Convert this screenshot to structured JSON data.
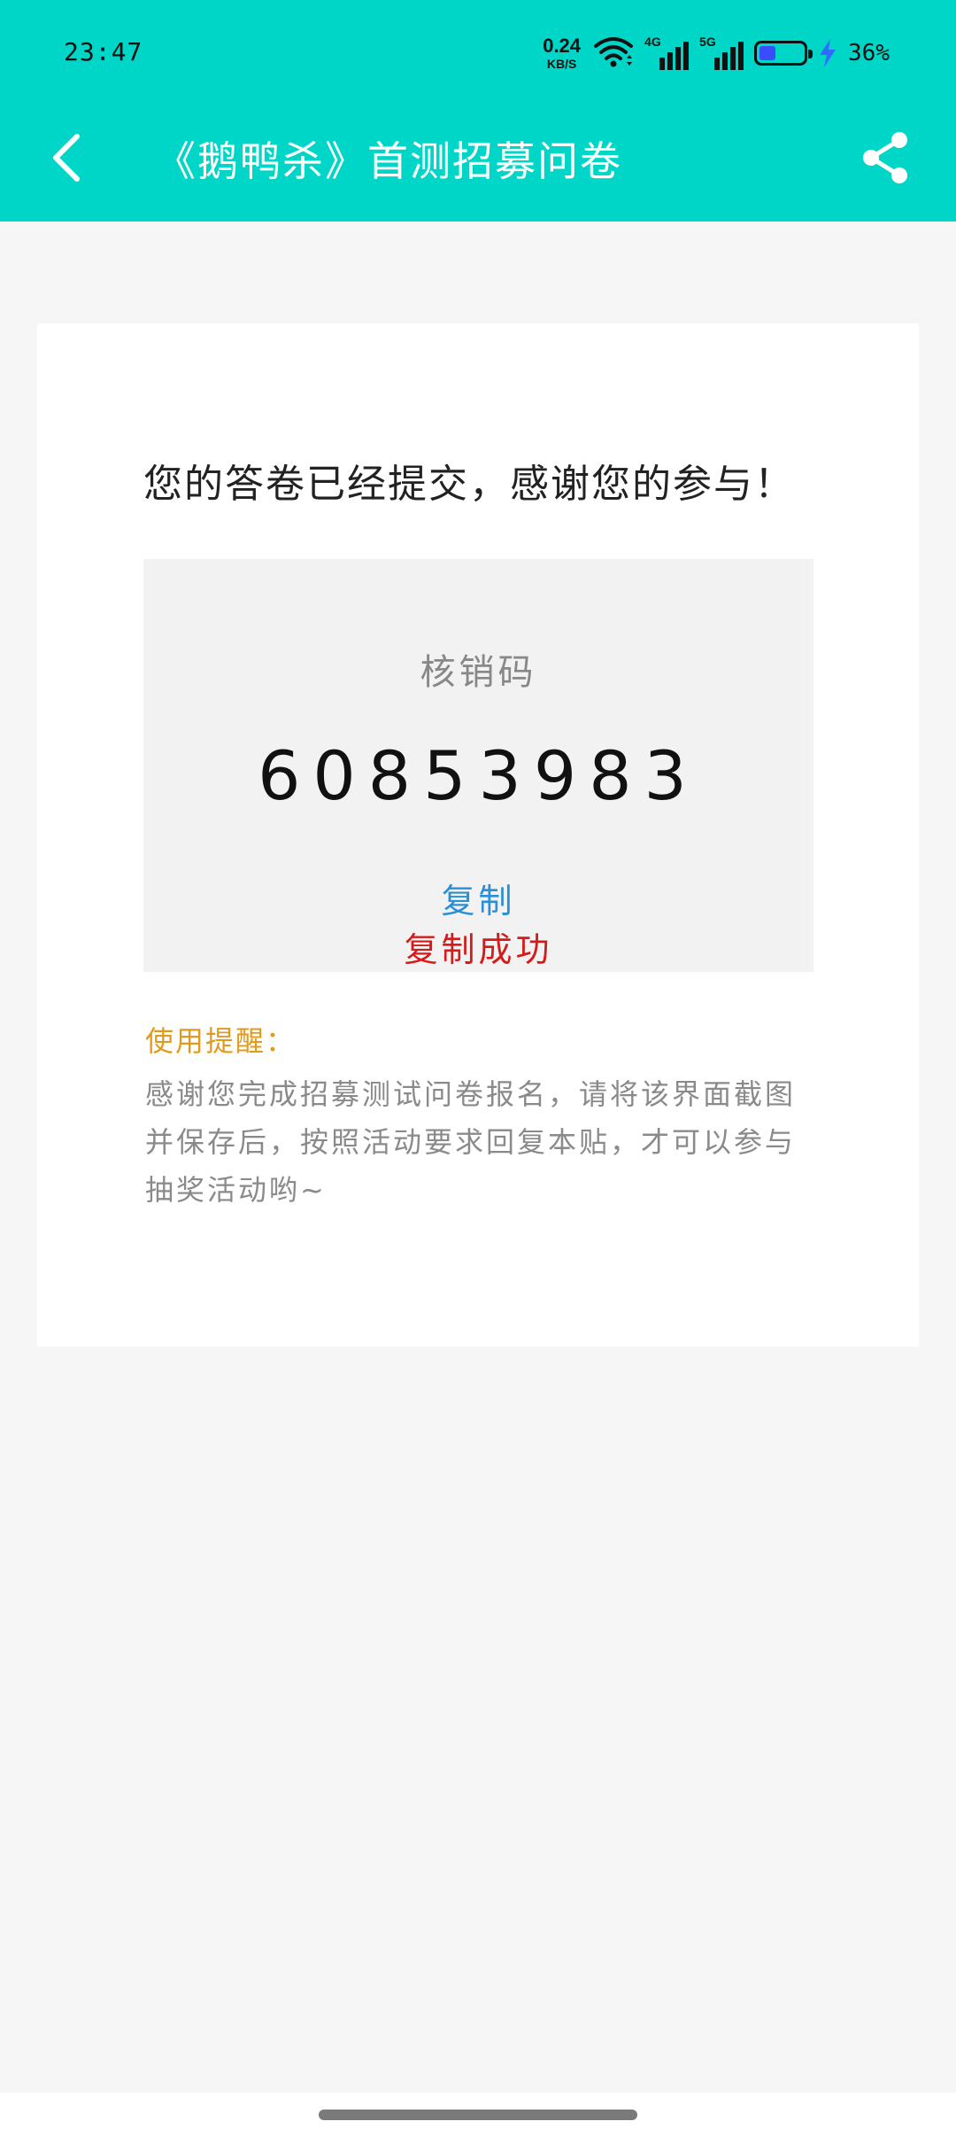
{
  "status_bar": {
    "time": "23:47",
    "net_speed_value": "0.24",
    "net_speed_unit": "KB/S",
    "sig1_label": "4G",
    "sig2_label": "5G",
    "battery_percent": "36%",
    "battery_level": 0.36,
    "icons": [
      "wifi-icon",
      "signal-4g-icon",
      "signal-5g-icon",
      "battery-icon",
      "charging-bolt-icon"
    ]
  },
  "app_bar": {
    "title": "《鹅鸭杀》首测招募问卷",
    "icons": [
      "back-arrow-icon",
      "share-icon"
    ]
  },
  "card": {
    "submitted_message": "您的答卷已经提交，感谢您的参与！",
    "code_label": "核销码",
    "code_value": "60853983",
    "copy_label": "复制",
    "copy_success": "复制成功",
    "tip_title": "使用提醒：",
    "tip_body": "感谢您完成招募测试问卷报名，请将该界面截图并保存后，按照活动要求回复本贴，才可以参与抽奖活动哟~"
  },
  "colors": {
    "header": "#00d6c7",
    "copy": "#2a8fd6",
    "success": "#d51a1a",
    "tip_title": "#e39a1c"
  }
}
